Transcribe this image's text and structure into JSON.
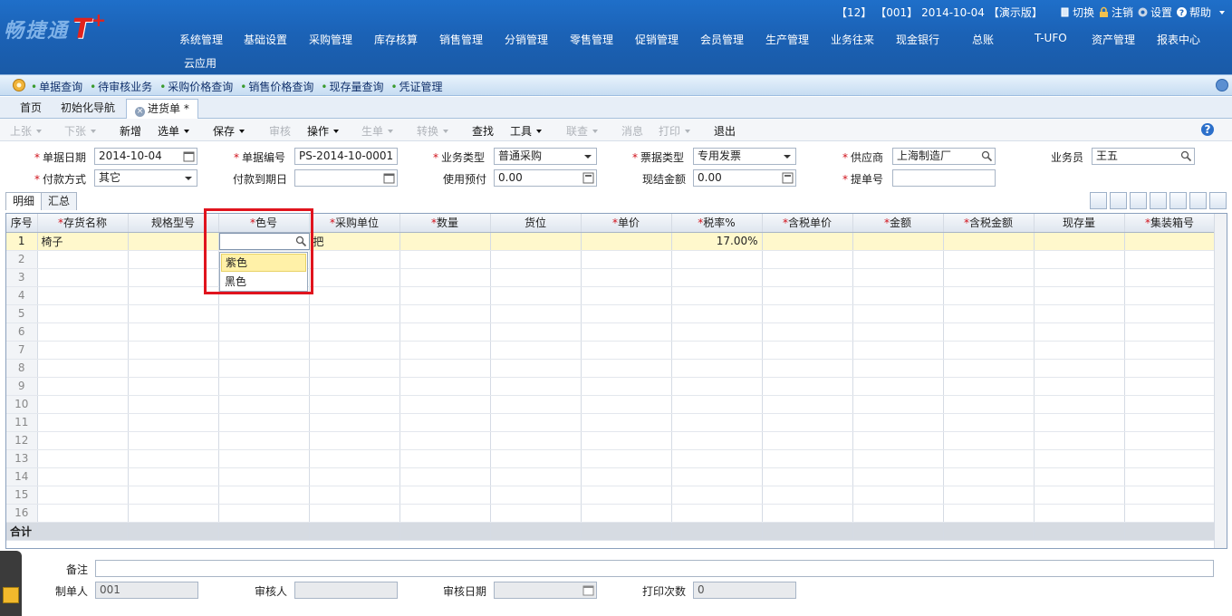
{
  "app": {
    "logo_text": "畅捷通",
    "logo_mark": "T",
    "logo_plus": "+",
    "status_bar": {
      "account_set": "【12】",
      "operator": "【001】",
      "date": "2014-10-04",
      "version": "【演示版】",
      "switch": "切换",
      "logout": "注销",
      "settings": "设置",
      "help": "帮助"
    }
  },
  "main_menu": [
    "系统管理",
    "基础设置",
    "采购管理",
    "库存核算",
    "销售管理",
    "分销管理",
    "零售管理",
    "促销管理",
    "会员管理",
    "生产管理",
    "业务往来",
    "现金银行",
    "总账",
    "T-UFO",
    "资产管理",
    "报表中心",
    "云应用"
  ],
  "quick_links": [
    "单据查询",
    "待审核业务",
    "采购价格查询",
    "销售价格查询",
    "现存量查询",
    "凭证管理"
  ],
  "tabs": [
    {
      "label": "首页",
      "active": false
    },
    {
      "label": "初始化导航",
      "active": false
    },
    {
      "label": "进货单 *",
      "active": true
    }
  ],
  "toolbar": [
    {
      "label": "上张",
      "enabled": false,
      "dropdown": true
    },
    {
      "label": "下张",
      "enabled": false,
      "dropdown": true
    },
    {
      "label": "新增",
      "enabled": true,
      "dropdown": false
    },
    {
      "label": "选单",
      "enabled": true,
      "dropdown": true
    },
    {
      "label": "保存",
      "enabled": true,
      "dropdown": true
    },
    {
      "label": "审核",
      "enabled": false,
      "dropdown": false
    },
    {
      "label": "操作",
      "enabled": true,
      "dropdown": true
    },
    {
      "label": "生单",
      "enabled": false,
      "dropdown": true
    },
    {
      "label": "转换",
      "enabled": false,
      "dropdown": true
    },
    {
      "label": "查找",
      "enabled": true,
      "dropdown": false
    },
    {
      "label": "工具",
      "enabled": true,
      "dropdown": true
    },
    {
      "label": "联查",
      "enabled": false,
      "dropdown": true
    },
    {
      "label": "消息",
      "enabled": false,
      "dropdown": false
    },
    {
      "label": "打印",
      "enabled": false,
      "dropdown": true
    },
    {
      "label": "退出",
      "enabled": true,
      "dropdown": false
    }
  ],
  "form": {
    "doc_date": {
      "label": "单据日期",
      "value": "2014-10-04"
    },
    "doc_no": {
      "label": "单据编号",
      "value": "PS-2014-10-0001"
    },
    "biz_type": {
      "label": "业务类型",
      "value": "普通采购"
    },
    "invoice_type": {
      "label": "票据类型",
      "value": "专用发票"
    },
    "supplier": {
      "label": "供应商",
      "value": "上海制造厂"
    },
    "salesman": {
      "label": "业务员",
      "value": "王五"
    },
    "pay_method": {
      "label": "付款方式",
      "value": "其它"
    },
    "pay_due": {
      "label": "付款到期日",
      "value": ""
    },
    "prepay": {
      "label": "使用预付",
      "value": "0.00"
    },
    "cash_amount": {
      "label": "现结金额",
      "value": "0.00"
    },
    "bill_no": {
      "label": "提单号",
      "value": ""
    }
  },
  "sub_tabs": [
    "明细",
    "汇总"
  ],
  "grid": {
    "columns": [
      {
        "label": "序号",
        "required": false
      },
      {
        "label": "存货名称",
        "required": true
      },
      {
        "label": "规格型号",
        "required": false
      },
      {
        "label": "色号",
        "required": true
      },
      {
        "label": "采购单位",
        "required": true
      },
      {
        "label": "数量",
        "required": true
      },
      {
        "label": "货位",
        "required": false
      },
      {
        "label": "单价",
        "required": true
      },
      {
        "label": "税率%",
        "required": true
      },
      {
        "label": "含税单价",
        "required": true
      },
      {
        "label": "金额",
        "required": true
      },
      {
        "label": "含税金额",
        "required": true
      },
      {
        "label": "现存量",
        "required": false
      },
      {
        "label": "集装箱号",
        "required": true
      }
    ],
    "rows": [
      {
        "seq": "1",
        "name": "椅子",
        "spec": "",
        "color": "",
        "unit": "把",
        "qty": "",
        "location": "",
        "price": "",
        "tax_rate": "17.00%",
        "tax_price": "",
        "amount": "",
        "tax_amount": "",
        "stock": "",
        "container": ""
      }
    ],
    "empty_row_numbers": [
      "2",
      "3",
      "4",
      "5",
      "6",
      "7",
      "8",
      "9",
      "10",
      "11",
      "12",
      "13",
      "14",
      "15",
      "16"
    ],
    "total_label": "合计",
    "color_options": [
      "紫色",
      "黑色"
    ],
    "selected_color_option": "紫色"
  },
  "footer": {
    "remark": {
      "label": "备注",
      "value": ""
    },
    "creator": {
      "label": "制单人",
      "value": "001"
    },
    "reviewer": {
      "label": "审核人",
      "value": ""
    },
    "review_date": {
      "label": "审核日期",
      "value": ""
    },
    "print_count": {
      "label": "打印次数",
      "value": "0"
    }
  },
  "colors": {
    "header_bg": "#1b62b6",
    "required_mark": "#d0101a",
    "highlight_box": "#e0141e",
    "selected_row": "#fff8cc"
  }
}
